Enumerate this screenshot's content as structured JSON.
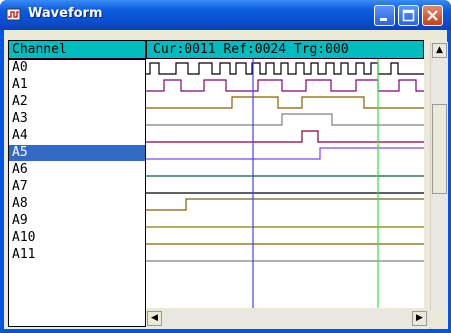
{
  "window": {
    "title": "Waveform"
  },
  "header": {
    "channel_label": "Channel",
    "status_text": "Cur:0011 Ref:0024 Trg:000"
  },
  "channels": [
    {
      "label": "A0"
    },
    {
      "label": "A1"
    },
    {
      "label": "A2"
    },
    {
      "label": "A3"
    },
    {
      "label": "A4"
    },
    {
      "label": "A5",
      "selected": true
    },
    {
      "label": "A6"
    },
    {
      "label": "A7"
    },
    {
      "label": "A8"
    },
    {
      "label": "A9"
    },
    {
      "label": "A10"
    },
    {
      "label": "A11"
    }
  ],
  "colors": {
    "header_bg": "#00bcbf",
    "selection": "#316ac5",
    "cursor_cur": "#4040ff",
    "cursor_ref": "#40e040",
    "trace_colors": [
      "#000000",
      "#800080",
      "#806000",
      "#808080",
      "#800040",
      "#8040ff",
      "#006040",
      "#000000",
      "#806000",
      "#808000",
      "#806000",
      "#808080"
    ]
  },
  "icons": {
    "app": "waveform-app-icon",
    "minimize": "minimize-icon",
    "maximize": "maximize-icon",
    "close": "close-icon",
    "scroll_up": "arrow-up-icon",
    "scroll_down": "arrow-down-icon",
    "scroll_left": "arrow-left-icon",
    "scroll_right": "arrow-right-icon"
  }
}
